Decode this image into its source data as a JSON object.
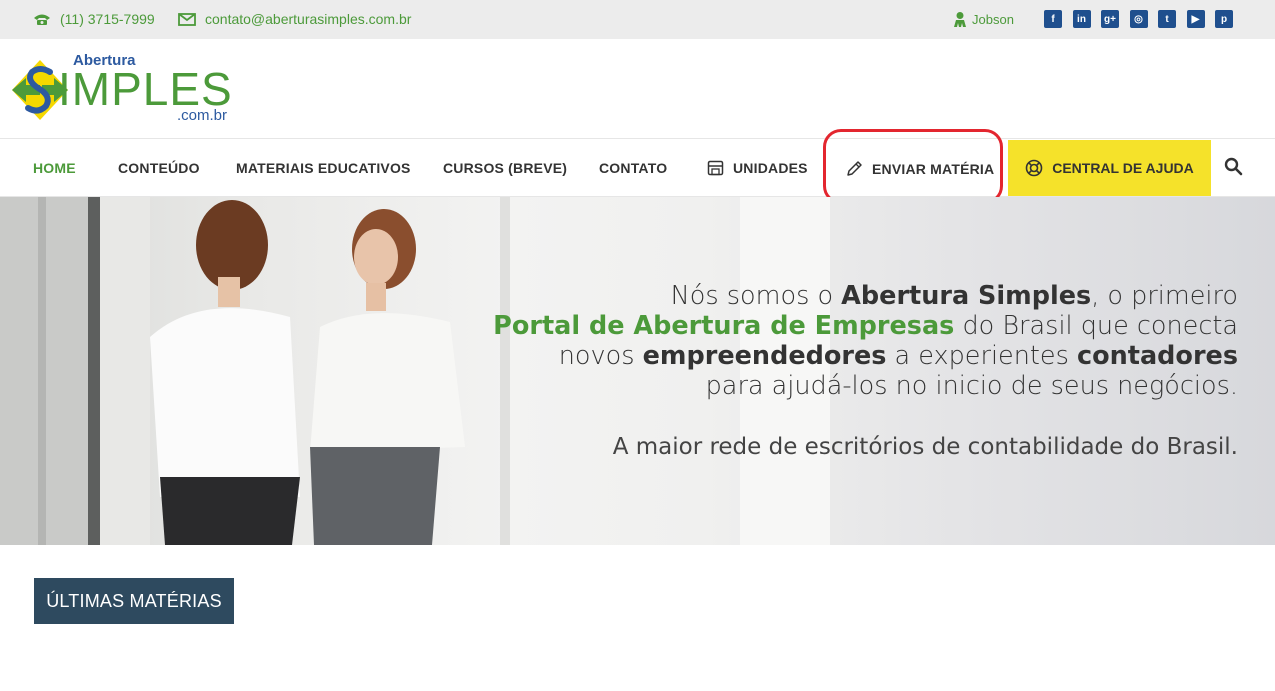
{
  "topbar": {
    "phone": "(11) 3715-7999",
    "email": "contato@aberturasimples.com.br",
    "user": "Jobson",
    "socials": [
      {
        "icon": "facebook-icon",
        "glyph": "f"
      },
      {
        "icon": "linkedin-icon",
        "glyph": "in"
      },
      {
        "icon": "google-plus-icon",
        "glyph": "g+"
      },
      {
        "icon": "instagram-icon",
        "glyph": "◎"
      },
      {
        "icon": "twitter-icon",
        "glyph": "t"
      },
      {
        "icon": "youtube-icon",
        "glyph": "▶"
      },
      {
        "icon": "pinterest-icon",
        "glyph": "p"
      }
    ]
  },
  "logo": {
    "top": "Abertura",
    "main": "IMPLES",
    "suffix": ".com.br"
  },
  "nav": {
    "home": "HOME",
    "conteudo": "CONTEÚDO",
    "materiais": "MATERIAIS EDUCATIVOS",
    "cursos": "CURSOS (BREVE)",
    "contato": "CONTATO",
    "unidades": "UNIDADES",
    "enviar": "ENVIAR MATÉRIA",
    "ajuda": "CENTRAL DE AJUDA"
  },
  "hero": {
    "l1a": "Nós somos o ",
    "l1b": "Abertura Simples",
    "l1c": ", o primeiro",
    "l2a": "Portal de Abertura de Empresas",
    "l2b": " do Brasil que conecta",
    "l3a": "novos ",
    "l3b": "empreendedores",
    "l3c": " a experientes ",
    "l3d": "contadores",
    "l4": "para ajudá-los no inicio de seus negócios.",
    "sub": "A maior rede de escritórios de contabilidade do Brasil."
  },
  "section": {
    "title": "ÚLTIMAS MATÉRIAS"
  },
  "colors": {
    "green": "#4c9a3a",
    "blue": "#1f4f8e",
    "yellow": "#f5e22a",
    "badge": "#2e4a5f",
    "highlight": "#e3262f"
  }
}
